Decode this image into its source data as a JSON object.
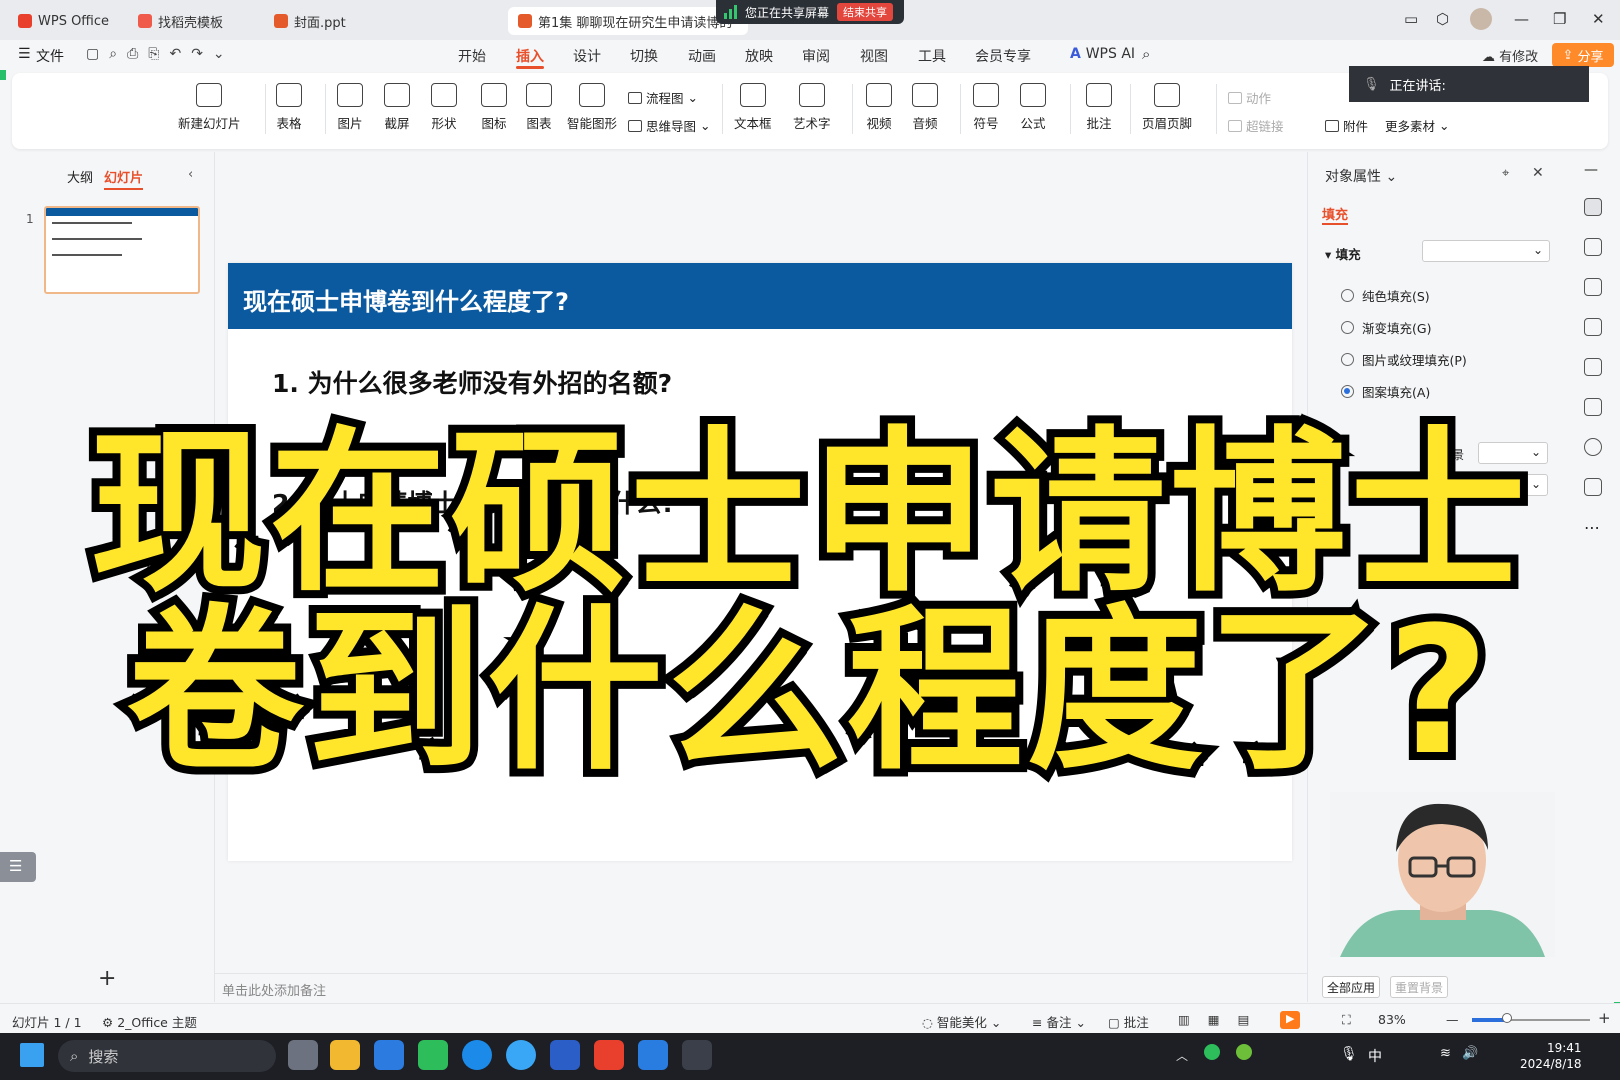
{
  "tabs": {
    "wps_office": "WPS Office",
    "template": "找稻壳模板",
    "file_ppt": "封面.ppt",
    "episode": "第1集 聊聊现在研究生申请读博的"
  },
  "share_banner": {
    "text": "您正在共享屏幕",
    "end": "结束共享"
  },
  "menu": {
    "file": "文件",
    "items": [
      "开始",
      "插入",
      "设计",
      "切换",
      "动画",
      "放映",
      "审阅",
      "视图",
      "工具",
      "会员专享"
    ],
    "ai": "WPS AI",
    "modify": "有修改",
    "share": "分享"
  },
  "speaking": "正在讲话:",
  "ribbon": {
    "new_slide": "新建幻灯片",
    "table": "表格",
    "picture": "图片",
    "screenshot": "截屏",
    "shape": "形状",
    "icon": "图标",
    "chart": "图表",
    "smart_shape": "智能图形",
    "flowchart": "流程图",
    "mindmap": "思维导图",
    "textbox": "文本框",
    "wordart": "艺术字",
    "video": "视频",
    "audio": "音频",
    "symbol": "符号",
    "formula": "公式",
    "comment": "批注",
    "header_footer": "页眉页脚",
    "action": "动作",
    "hyperlink": "超链接",
    "attachment": "附件",
    "more_material": "更多素材"
  },
  "left_panel": {
    "outline_tab": "大纲",
    "slides_tab": "幻灯片",
    "slide_number": "1"
  },
  "slide": {
    "title": "现在硕士申博卷到什么程度了?",
    "bullet1": "1. 为什么很多老师没有外招的名额?",
    "bullet2": "2. 硕士申请博士需要...老师看什么?"
  },
  "notes_placeholder": "单击此处添加备注",
  "properties": {
    "title": "对象属性",
    "fill_tab": "填充",
    "fill_section": "填充",
    "options": [
      "纯色填充(S)",
      "渐变填充(G)",
      "图片或纹理填充(P)",
      "图案填充(A)"
    ],
    "fg_label": "前景",
    "bg_label": "背景",
    "apply_all": "全部应用",
    "reset_bg": "重置背景"
  },
  "status": {
    "slide_count": "幻灯片 1 / 1",
    "theme": "2_Office 主题",
    "smart_beautify": "智能美化",
    "notes": "备注",
    "comments": "批注",
    "zoom": "83%",
    "zoom_fraction": 0.3
  },
  "taskbar": {
    "search": "搜索",
    "time": "19:41",
    "date": "2024/8/18",
    "ime": "中"
  },
  "overlay": {
    "line1": "现在硕士申请博士",
    "line2": "卷到什么程度了?"
  },
  "colors": {
    "accent": "#e8502c",
    "slide_header": "#0b5aa0",
    "overlay_text": "#ffe62b",
    "share_btn": "#ff8a2a"
  }
}
